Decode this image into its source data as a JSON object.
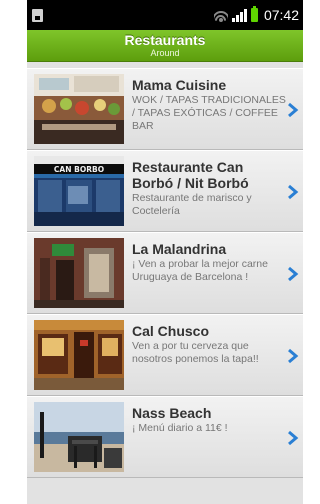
{
  "status_bar": {
    "time": "07:42"
  },
  "header": {
    "title": "Restaurants",
    "subtitle": "Around"
  },
  "restaurants": [
    {
      "name": "Mama Cuisine",
      "description": "WOK / TAPAS TRADICIONALES / TAPAS EXÓTICAS / COFFEE BAR"
    },
    {
      "name": "Restaurante Can Borbó / Nit Borbó",
      "description": "Restaurante de marisco y Coctelería"
    },
    {
      "name": "La Malandrina",
      "description": "¡ Ven a probar la mejor carne Uruguaya de Barcelona !"
    },
    {
      "name": "Cal Chusco",
      "description": "Ven a por tu cerveza que nosotros ponemos la tapa!!"
    },
    {
      "name": "Nass Beach",
      "description": "¡ Menú diario a 11€ !"
    }
  ],
  "photo_signs": {
    "can_borbo": "CAN BORBO"
  },
  "colors": {
    "header_green": "#6cb31c",
    "chevron_blue": "#2a7fd4",
    "battery_green": "#5fd400"
  },
  "icons": [
    "sd-card-icon",
    "wifi-icon",
    "signal-icon",
    "battery-icon",
    "chevron-right-icon"
  ]
}
